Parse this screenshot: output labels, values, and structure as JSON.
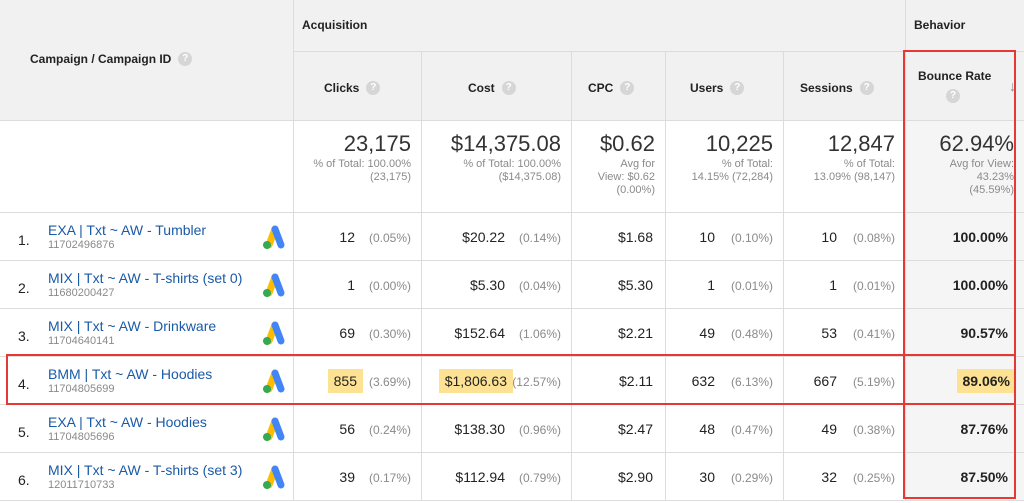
{
  "headers": {
    "dimension": "Campaign / Campaign ID",
    "groups": {
      "acquisition": "Acquisition",
      "behavior": "Behavior"
    },
    "columns": {
      "clicks": "Clicks",
      "cost": "Cost",
      "cpc": "CPC",
      "users": "Users",
      "sessions": "Sessions",
      "bounce_rate": "Bounce Rate"
    },
    "help_glyph": "?",
    "sort_glyph": "↓"
  },
  "totals": {
    "clicks": {
      "value": "23,175",
      "sub1": "% of Total: 100.00%",
      "sub2": "(23,175)"
    },
    "cost": {
      "value": "$14,375.08",
      "sub1": "% of Total: 100.00%",
      "sub2": "($14,375.08)"
    },
    "cpc": {
      "value": "$0.62",
      "sub1": "Avg for",
      "sub2": "View: $0.62",
      "sub3": "(0.00%)"
    },
    "users": {
      "value": "10,225",
      "sub1": "% of Total:",
      "sub2": "14.15% (72,284)"
    },
    "sessions": {
      "value": "12,847",
      "sub1": "% of Total:",
      "sub2": "13.09% (98,147)"
    },
    "bounce_rate": {
      "value": "62.94%",
      "sub1": "Avg for View:",
      "sub2": "43.23%",
      "sub3": "(45.59%)"
    }
  },
  "rows": [
    {
      "num": "1.",
      "name": "EXA | Txt ~ AW - Tumbler",
      "id": "11702496876",
      "clicks": "12",
      "clicks_pct": "(0.05%)",
      "cost": "$20.22",
      "cost_pct": "(0.14%)",
      "cpc": "$1.68",
      "users": "10",
      "users_pct": "(0.10%)",
      "sessions": "10",
      "sessions_pct": "(0.08%)",
      "bounce_rate": "100.00%"
    },
    {
      "num": "2.",
      "name": "MIX | Txt ~ AW - T-shirts (set 0)",
      "id": "11680200427",
      "clicks": "1",
      "clicks_pct": "(0.00%)",
      "cost": "$5.30",
      "cost_pct": "(0.04%)",
      "cpc": "$5.30",
      "users": "1",
      "users_pct": "(0.01%)",
      "sessions": "1",
      "sessions_pct": "(0.01%)",
      "bounce_rate": "100.00%"
    },
    {
      "num": "3.",
      "name": "MIX | Txt ~ AW - Drinkware",
      "id": "11704640141",
      "clicks": "69",
      "clicks_pct": "(0.30%)",
      "cost": "$152.64",
      "cost_pct": "(1.06%)",
      "cpc": "$2.21",
      "users": "49",
      "users_pct": "(0.48%)",
      "sessions": "53",
      "sessions_pct": "(0.41%)",
      "bounce_rate": "90.57%"
    },
    {
      "num": "4.",
      "name": "BMM | Txt ~ AW - Hoodies",
      "id": "11704805699",
      "clicks": "855",
      "clicks_pct": "(3.69%)",
      "cost": "$1,806.63",
      "cost_pct": "(12.57%)",
      "cpc": "$2.11",
      "users": "632",
      "users_pct": "(6.13%)",
      "sessions": "667",
      "sessions_pct": "(5.19%)",
      "bounce_rate": "89.06%"
    },
    {
      "num": "5.",
      "name": "EXA | Txt ~ AW - Hoodies",
      "id": "11704805696",
      "clicks": "56",
      "clicks_pct": "(0.24%)",
      "cost": "$138.30",
      "cost_pct": "(0.96%)",
      "cpc": "$2.47",
      "users": "48",
      "users_pct": "(0.47%)",
      "sessions": "49",
      "sessions_pct": "(0.38%)",
      "bounce_rate": "87.76%"
    },
    {
      "num": "6.",
      "name": "MIX | Txt ~ AW - T-shirts (set 3)",
      "id": "12011710733",
      "clicks": "39",
      "clicks_pct": "(0.17%)",
      "cost": "$112.94",
      "cost_pct": "(0.79%)",
      "cpc": "$2.90",
      "users": "30",
      "users_pct": "(0.29%)",
      "sessions": "32",
      "sessions_pct": "(0.25%)",
      "bounce_rate": "87.50%"
    }
  ],
  "colors": {
    "header_bg": "#f1f1f1",
    "link": "#1a5aa8",
    "highlight": "#fde293",
    "annotation_red": "#e53935",
    "ads_blue": "#4285f4",
    "ads_yellow": "#fbbc04",
    "ads_green": "#34a853"
  },
  "icons": {
    "campaign_source": "google-ads-icon"
  }
}
